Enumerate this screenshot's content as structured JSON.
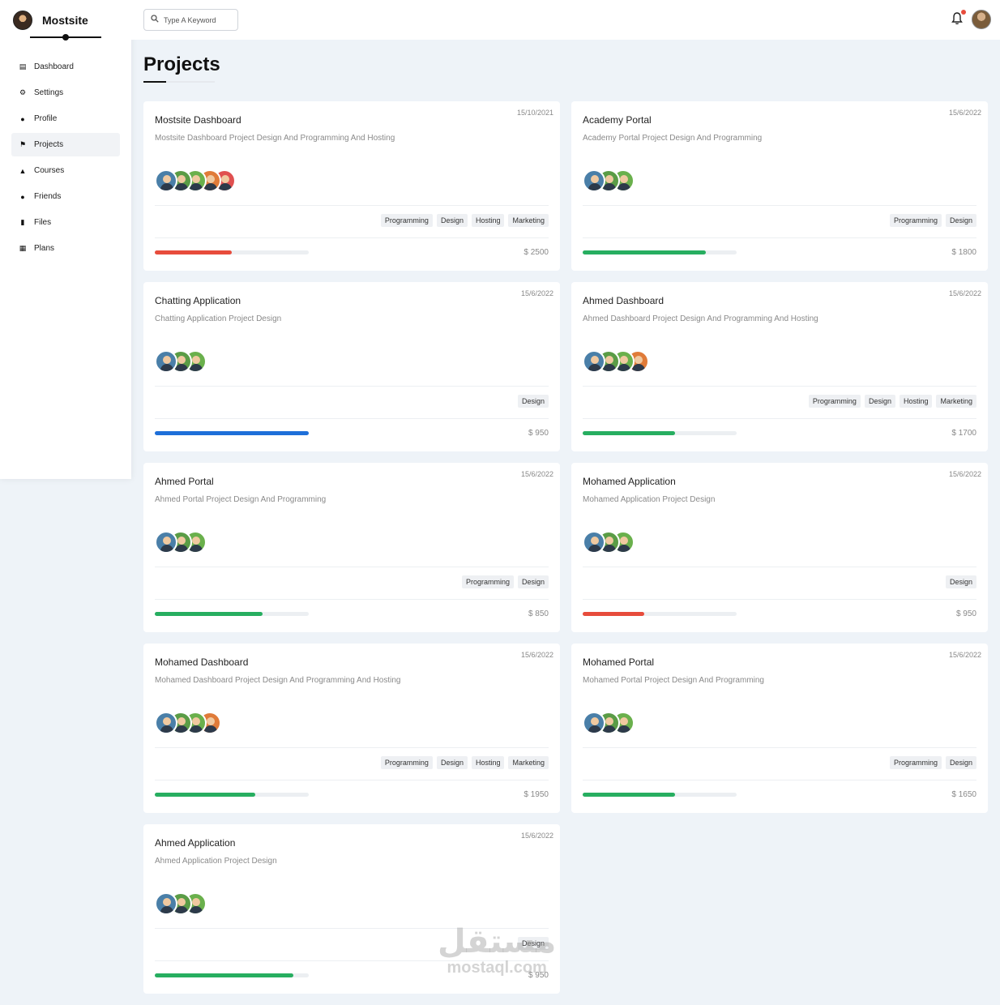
{
  "brand": {
    "name": "Mostsite"
  },
  "search": {
    "placeholder": "Type A Keyword"
  },
  "sidebar": {
    "items": [
      {
        "label": "Dashboard",
        "icon": "chart-icon",
        "glyph": "▤",
        "active": false
      },
      {
        "label": "Settings",
        "icon": "gear-icon",
        "glyph": "⚙",
        "active": false
      },
      {
        "label": "Profile",
        "icon": "user-icon",
        "glyph": "●",
        "active": false
      },
      {
        "label": "Projects",
        "icon": "diagram-icon",
        "glyph": "⚑",
        "active": true
      },
      {
        "label": "Courses",
        "icon": "graduation-cap-icon",
        "glyph": "▲",
        "active": false
      },
      {
        "label": "Friends",
        "icon": "users-icon",
        "glyph": "●",
        "active": false
      },
      {
        "label": "Files",
        "icon": "file-icon",
        "glyph": "▮",
        "active": false
      },
      {
        "label": "Plans",
        "icon": "calendar-icon",
        "glyph": "▦",
        "active": false
      }
    ]
  },
  "page": {
    "title": "Projects"
  },
  "colors": {
    "red": "#e74c3c",
    "green": "#27ae60",
    "blue": "#1e6fd9"
  },
  "projects": [
    {
      "name": "Mostsite Dashboard",
      "date": "15/10/2021",
      "desc": "Mostsite Dashboard Project Design And Programming And Hosting",
      "avatars": 5,
      "tags": [
        "Programming",
        "Design",
        "Hosting",
        "Marketing"
      ],
      "progress": 0.5,
      "color": "#e74c3c",
      "price": "$ 2500"
    },
    {
      "name": "Academy Portal",
      "date": "15/6/2022",
      "desc": "Academy Portal Project Design And Programming",
      "avatars": 3,
      "tags": [
        "Programming",
        "Design"
      ],
      "progress": 0.8,
      "color": "#27ae60",
      "price": "$ 1800"
    },
    {
      "name": "Chatting Application",
      "date": "15/6/2022",
      "desc": "Chatting Application Project Design",
      "avatars": 3,
      "tags": [
        "Design"
      ],
      "progress": 1.0,
      "color": "#1e6fd9",
      "price": "$ 950"
    },
    {
      "name": "Ahmed Dashboard",
      "date": "15/6/2022",
      "desc": "Ahmed Dashboard Project Design And Programming And Hosting",
      "avatars": 4,
      "tags": [
        "Programming",
        "Design",
        "Hosting",
        "Marketing"
      ],
      "progress": 0.6,
      "color": "#27ae60",
      "price": "$ 1700"
    },
    {
      "name": "Ahmed Portal",
      "date": "15/6/2022",
      "desc": "Ahmed Portal Project Design And Programming",
      "avatars": 3,
      "tags": [
        "Programming",
        "Design"
      ],
      "progress": 0.7,
      "color": "#27ae60",
      "price": "$ 850"
    },
    {
      "name": "Mohamed Application",
      "date": "15/6/2022",
      "desc": "Mohamed Application Project Design",
      "avatars": 3,
      "tags": [
        "Design"
      ],
      "progress": 0.4,
      "color": "#e74c3c",
      "price": "$ 950"
    },
    {
      "name": "Mohamed Dashboard",
      "date": "15/6/2022",
      "desc": "Mohamed Dashboard Project Design And Programming And Hosting",
      "avatars": 4,
      "tags": [
        "Programming",
        "Design",
        "Hosting",
        "Marketing"
      ],
      "progress": 0.65,
      "color": "#27ae60",
      "price": "$ 1950"
    },
    {
      "name": "Mohamed Portal",
      "date": "15/6/2022",
      "desc": "Mohamed Portal Project Design And Programming",
      "avatars": 3,
      "tags": [
        "Programming",
        "Design"
      ],
      "progress": 0.6,
      "color": "#27ae60",
      "price": "$ 1650"
    },
    {
      "name": "Ahmed Application",
      "date": "15/6/2022",
      "desc": "Ahmed Application Project Design",
      "avatars": 3,
      "tags": [
        "Design"
      ],
      "progress": 0.9,
      "color": "#27ae60",
      "price": "$ 950"
    }
  ],
  "watermark": {
    "arabic": "مستقل",
    "latin": "mostaql.com"
  }
}
